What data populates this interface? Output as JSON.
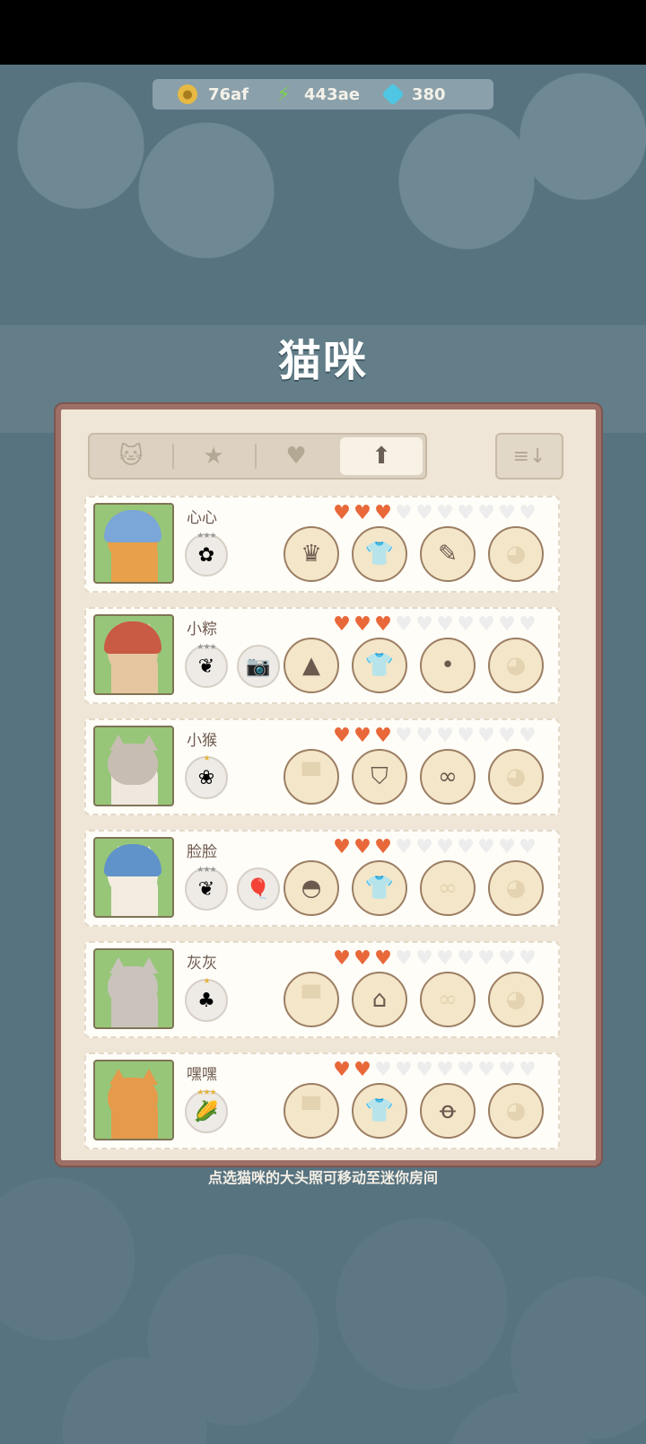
{
  "resources": {
    "coins": "76af",
    "energy": "443ae",
    "gems": "380"
  },
  "title": "猫咪",
  "tabs": [
    {
      "icon": "cat-icon",
      "active": false
    },
    {
      "icon": "star-icon",
      "active": false
    },
    {
      "icon": "heart-icon",
      "active": false
    },
    {
      "icon": "arrow-up-icon",
      "active": true
    }
  ],
  "sort_icon": "sort-descending-icon",
  "cats": [
    {
      "name": "心心",
      "hearts_filled": 3,
      "hearts_total": 10,
      "skills": [
        {
          "icon": "lotus-root-icon",
          "stars": 3,
          "gold": false
        }
      ],
      "equipment": [
        {
          "slot": "hat",
          "item": "jester-hat-icon",
          "filled": true
        },
        {
          "slot": "outfit",
          "item": "shirt-icon",
          "filled": false
        },
        {
          "slot": "accessory",
          "item": "wand-icon",
          "filled": true
        },
        {
          "slot": "extra",
          "item": "cat-face-icon",
          "filled": false
        }
      ]
    },
    {
      "name": "小粽",
      "hearts_filled": 3,
      "hearts_total": 10,
      "skills": [
        {
          "icon": "wheat-icon",
          "stars": 3,
          "gold": false
        },
        {
          "icon": "camera-icon",
          "stars": 0,
          "gold": false
        }
      ],
      "equipment": [
        {
          "slot": "hat",
          "item": "red-hood-icon",
          "filled": true
        },
        {
          "slot": "outfit",
          "item": "shirt-icon",
          "filled": false
        },
        {
          "slot": "accessory",
          "item": "dot-icon",
          "filled": true
        },
        {
          "slot": "extra",
          "item": "cat-face-icon",
          "filled": false
        }
      ]
    },
    {
      "name": "小猴",
      "hearts_filled": 3,
      "hearts_total": 10,
      "skills": [
        {
          "icon": "cabbage-icon",
          "stars": 1,
          "gold": true
        }
      ],
      "equipment": [
        {
          "slot": "hat",
          "item": "top-hat-icon",
          "filled": false
        },
        {
          "slot": "outfit",
          "item": "vest-icon",
          "filled": true
        },
        {
          "slot": "accessory",
          "item": "glasses-icon",
          "filled": true
        },
        {
          "slot": "extra",
          "item": "cat-face-icon",
          "filled": false
        }
      ]
    },
    {
      "name": "脸脸",
      "hearts_filled": 3,
      "hearts_total": 10,
      "skills": [
        {
          "icon": "wheat-icon",
          "stars": 3,
          "gold": false
        },
        {
          "icon": "balloon-icon",
          "stars": 0,
          "gold": false
        }
      ],
      "equipment": [
        {
          "slot": "hat",
          "item": "blue-cap-icon",
          "filled": true
        },
        {
          "slot": "outfit",
          "item": "shirt-icon",
          "filled": false
        },
        {
          "slot": "accessory",
          "item": "glasses-icon",
          "filled": false
        },
        {
          "slot": "extra",
          "item": "cat-face-icon",
          "filled": false
        }
      ]
    },
    {
      "name": "灰灰",
      "hearts_filled": 3,
      "hearts_total": 10,
      "skills": [
        {
          "icon": "broccoli-icon",
          "stars": 1,
          "gold": true
        }
      ],
      "equipment": [
        {
          "slot": "hat",
          "item": "top-hat-icon",
          "filled": false
        },
        {
          "slot": "outfit",
          "item": "overalls-icon",
          "filled": true
        },
        {
          "slot": "accessory",
          "item": "glasses-icon",
          "filled": false
        },
        {
          "slot": "extra",
          "item": "cat-face-icon",
          "filled": false
        }
      ]
    },
    {
      "name": "嘿嘿",
      "hearts_filled": 2,
      "hearts_total": 10,
      "skills": [
        {
          "icon": "corn-icon",
          "stars": 3,
          "gold": true
        }
      ],
      "equipment": [
        {
          "slot": "hat",
          "item": "top-hat-icon",
          "filled": false
        },
        {
          "slot": "outfit",
          "item": "shirt-icon",
          "filled": false
        },
        {
          "slot": "accessory",
          "item": "bell-icon",
          "filled": true
        },
        {
          "slot": "extra",
          "item": "cat-face-icon",
          "filled": false
        }
      ]
    }
  ],
  "hint": "点选猫咪的大头照可移动至迷你房间",
  "colors": {
    "heart_on": "#e8683a",
    "heart_off": "#ededed",
    "panel_bg": "#f0e6d7",
    "panel_border": "#9d6f67",
    "portrait_bg": "#97c679"
  }
}
